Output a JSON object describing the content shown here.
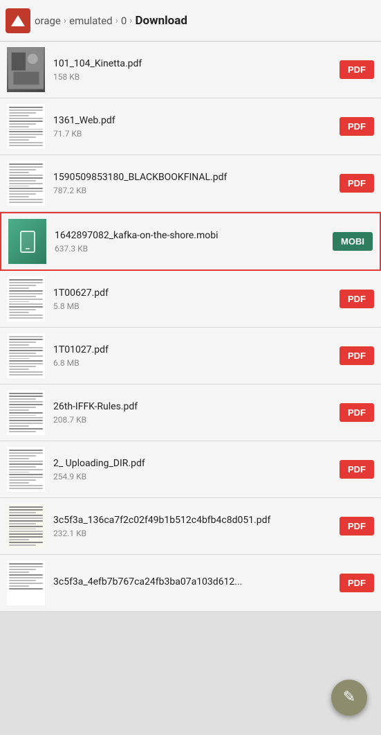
{
  "header": {
    "breadcrumb": [
      "orage",
      "emulated",
      "0",
      "Download"
    ],
    "separators": [
      "›",
      "›",
      "›"
    ]
  },
  "files": [
    {
      "name": "101_104_Kinetta.pdf",
      "size": "158 KB",
      "type": "PDF",
      "thumb": "photo",
      "selected": false
    },
    {
      "name": "1361_Web.pdf",
      "size": "71.7 KB",
      "type": "PDF",
      "thumb": "doc",
      "selected": false
    },
    {
      "name": "1590509853180_BLACKBOOKFINAL.pdf",
      "size": "787.2 KB",
      "type": "PDF",
      "thumb": "doc",
      "selected": false
    },
    {
      "name": "1642897082_kafka-on-the-shore.mobi",
      "size": "637.3 KB",
      "type": "MOBI",
      "thumb": "mobi",
      "selected": true
    },
    {
      "name": "1T00627.pdf",
      "size": "5.8 MB",
      "type": "PDF",
      "thumb": "doc",
      "selected": false
    },
    {
      "name": "1T01027.pdf",
      "size": "6.8 MB",
      "type": "PDF",
      "thumb": "doc",
      "selected": false
    },
    {
      "name": "26th-IFFK-Rules.pdf",
      "size": "208.7 KB",
      "type": "PDF",
      "thumb": "doc-lines",
      "selected": false
    },
    {
      "name": "2_ Uploading_DIR.pdf",
      "size": "254.9 KB",
      "type": "PDF",
      "thumb": "doc",
      "selected": false
    },
    {
      "name": "3c5f3a_136ca7f2c02f49b1b512c4bfb4c8d051.pdf",
      "size": "232.1 KB",
      "type": "PDF",
      "thumb": "doc-text",
      "selected": false
    },
    {
      "name": "3c5f3a_4efb7b767ca24fb3ba07a103d612...",
      "size": "",
      "type": "PDF",
      "thumb": "doc",
      "selected": false
    }
  ],
  "fab": {
    "icon": "✎",
    "label": "edit"
  },
  "buttons": {
    "pdf_label": "PDF",
    "mobi_label": "MOBI"
  }
}
